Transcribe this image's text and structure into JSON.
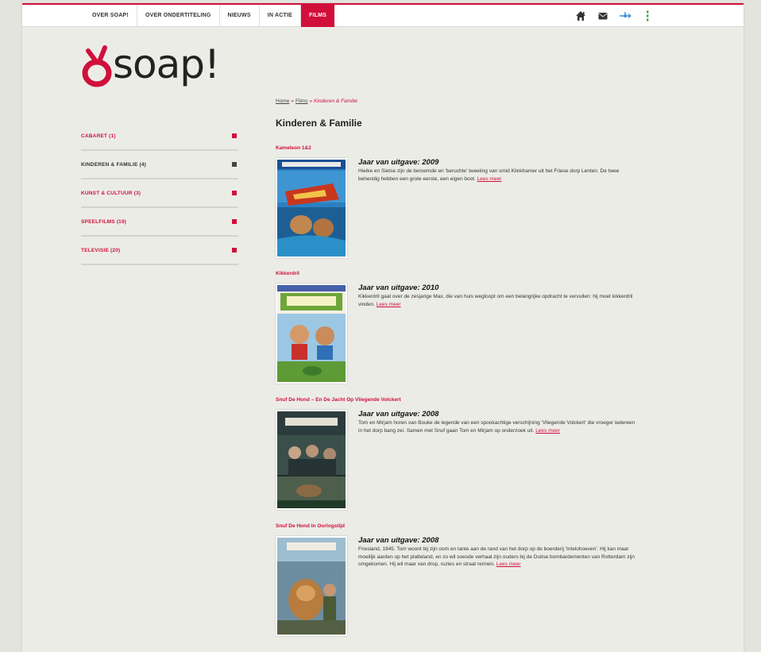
{
  "nav": {
    "items": [
      {
        "label": "OVER SOAP!",
        "active": false
      },
      {
        "label": "OVER ONDERTITELING",
        "active": false
      },
      {
        "label": "NIEUWS",
        "active": false
      },
      {
        "label": "IN ACTIE",
        "active": false
      },
      {
        "label": "FILMS",
        "active": true
      }
    ],
    "icons": [
      "home-icon",
      "mail-icon",
      "share-icon",
      "menu-dots-icon"
    ]
  },
  "logo": {
    "text": "soap!"
  },
  "sidebar": {
    "items": [
      {
        "label": "CABARET (1)",
        "current": false
      },
      {
        "label": "KINDEREN & FAMILIE (4)",
        "current": true
      },
      {
        "label": "KUNST & CULTUUR (3)",
        "current": false
      },
      {
        "label": "SPEELFILMS (19)",
        "current": false
      },
      {
        "label": "TELEVISIE (20)",
        "current": false
      }
    ]
  },
  "breadcrumb": {
    "home": "Home",
    "films": "Films",
    "current": "Kinderen & Familie",
    "separator": "»"
  },
  "page_title": "Kinderen & Familie",
  "films": [
    {
      "title": "Kameleon 1&2",
      "year_label": "Jaar van uitgave: 2009",
      "description": "Hielke en Sietse zijn de beroemde en 'beruchte' tweeling van smid Klinkhamer uit het Friese dorp Lenten. De twee behendig hebben een grote eerste, een eigen boot.",
      "more": "Lees meer"
    },
    {
      "title": "Kikkerdril",
      "year_label": "Jaar van uitgave: 2010",
      "description": "Kikkerdril gaat over de zesjarige Max, die van huis wegloopt om een belangrijke opdracht te vervullen: hij moet kikkerdril vinden.",
      "more": "Lees meer"
    },
    {
      "title": "Snuf De Hond – En De Jacht Op Vliegende Volckert",
      "year_label": "Jaar van uitgave: 2008",
      "description": "Tom en Mirjam horen van Bouke de legende van een spookachtige verschijning 'Vliegende Volckert' die vroeger iedereen in het dorp bang zei. Samen met Snuf gaan Tom en Mirjam op onderzoek uit.",
      "more": "Lees meer"
    },
    {
      "title": "Snuf De Hond In Oorlogstijd",
      "year_label": "Jaar van uitgave: 2008",
      "description": "Friesland, 1945. Tom woont bij zijn oom en tante aan de rand van het dorp op de boerderij 'Intelohoeven'. Hij kan maar moeilijk aarden op het platteland, en zo wil soesde verhaal zijn ouders bij de Duitse bombardementen van Rotterdam zijn omgekomen. Hij wil maar van drop, ruzies en straat rennen.",
      "more": "Lees meer"
    }
  ],
  "colors": {
    "brand": "#d0103a",
    "background": "#ecece7"
  }
}
